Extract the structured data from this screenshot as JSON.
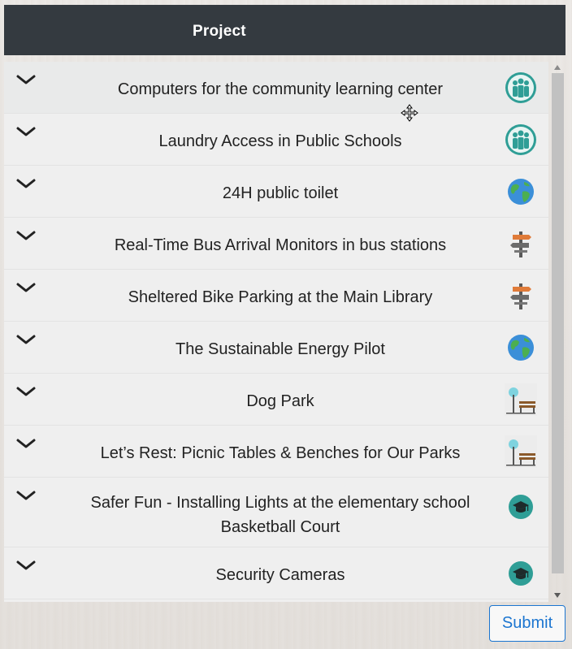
{
  "header": {
    "title": "Project"
  },
  "projects": [
    {
      "title": "Computers for the community learning center",
      "category_icon": "community-people-icon"
    },
    {
      "title": "Laundry Access in Public Schools",
      "category_icon": "community-people-icon"
    },
    {
      "title": "24H public toilet",
      "category_icon": "earth-globe-icon"
    },
    {
      "title": "Real-Time Bus Arrival Monitors in bus stations",
      "category_icon": "signpost-icon"
    },
    {
      "title": "Sheltered Bike Parking at the Main Library",
      "category_icon": "signpost-icon"
    },
    {
      "title": "The Sustainable Energy Pilot",
      "category_icon": "earth-globe-icon"
    },
    {
      "title": "Dog Park",
      "category_icon": "park-bench-icon"
    },
    {
      "title": "Let’s Rest: Picnic Tables & Benches for Our Parks",
      "category_icon": "park-bench-icon"
    },
    {
      "title": "Safer Fun - Installing Lights at the elementary school Basketball Court",
      "category_icon": "graduation-cap-icon"
    },
    {
      "title": "Security Cameras",
      "category_icon": "graduation-cap-icon"
    }
  ],
  "submit_label": "Submit",
  "colors": {
    "header_bg": "#343a40",
    "accent": "#1b75d0",
    "teal": "#2f9e96"
  }
}
